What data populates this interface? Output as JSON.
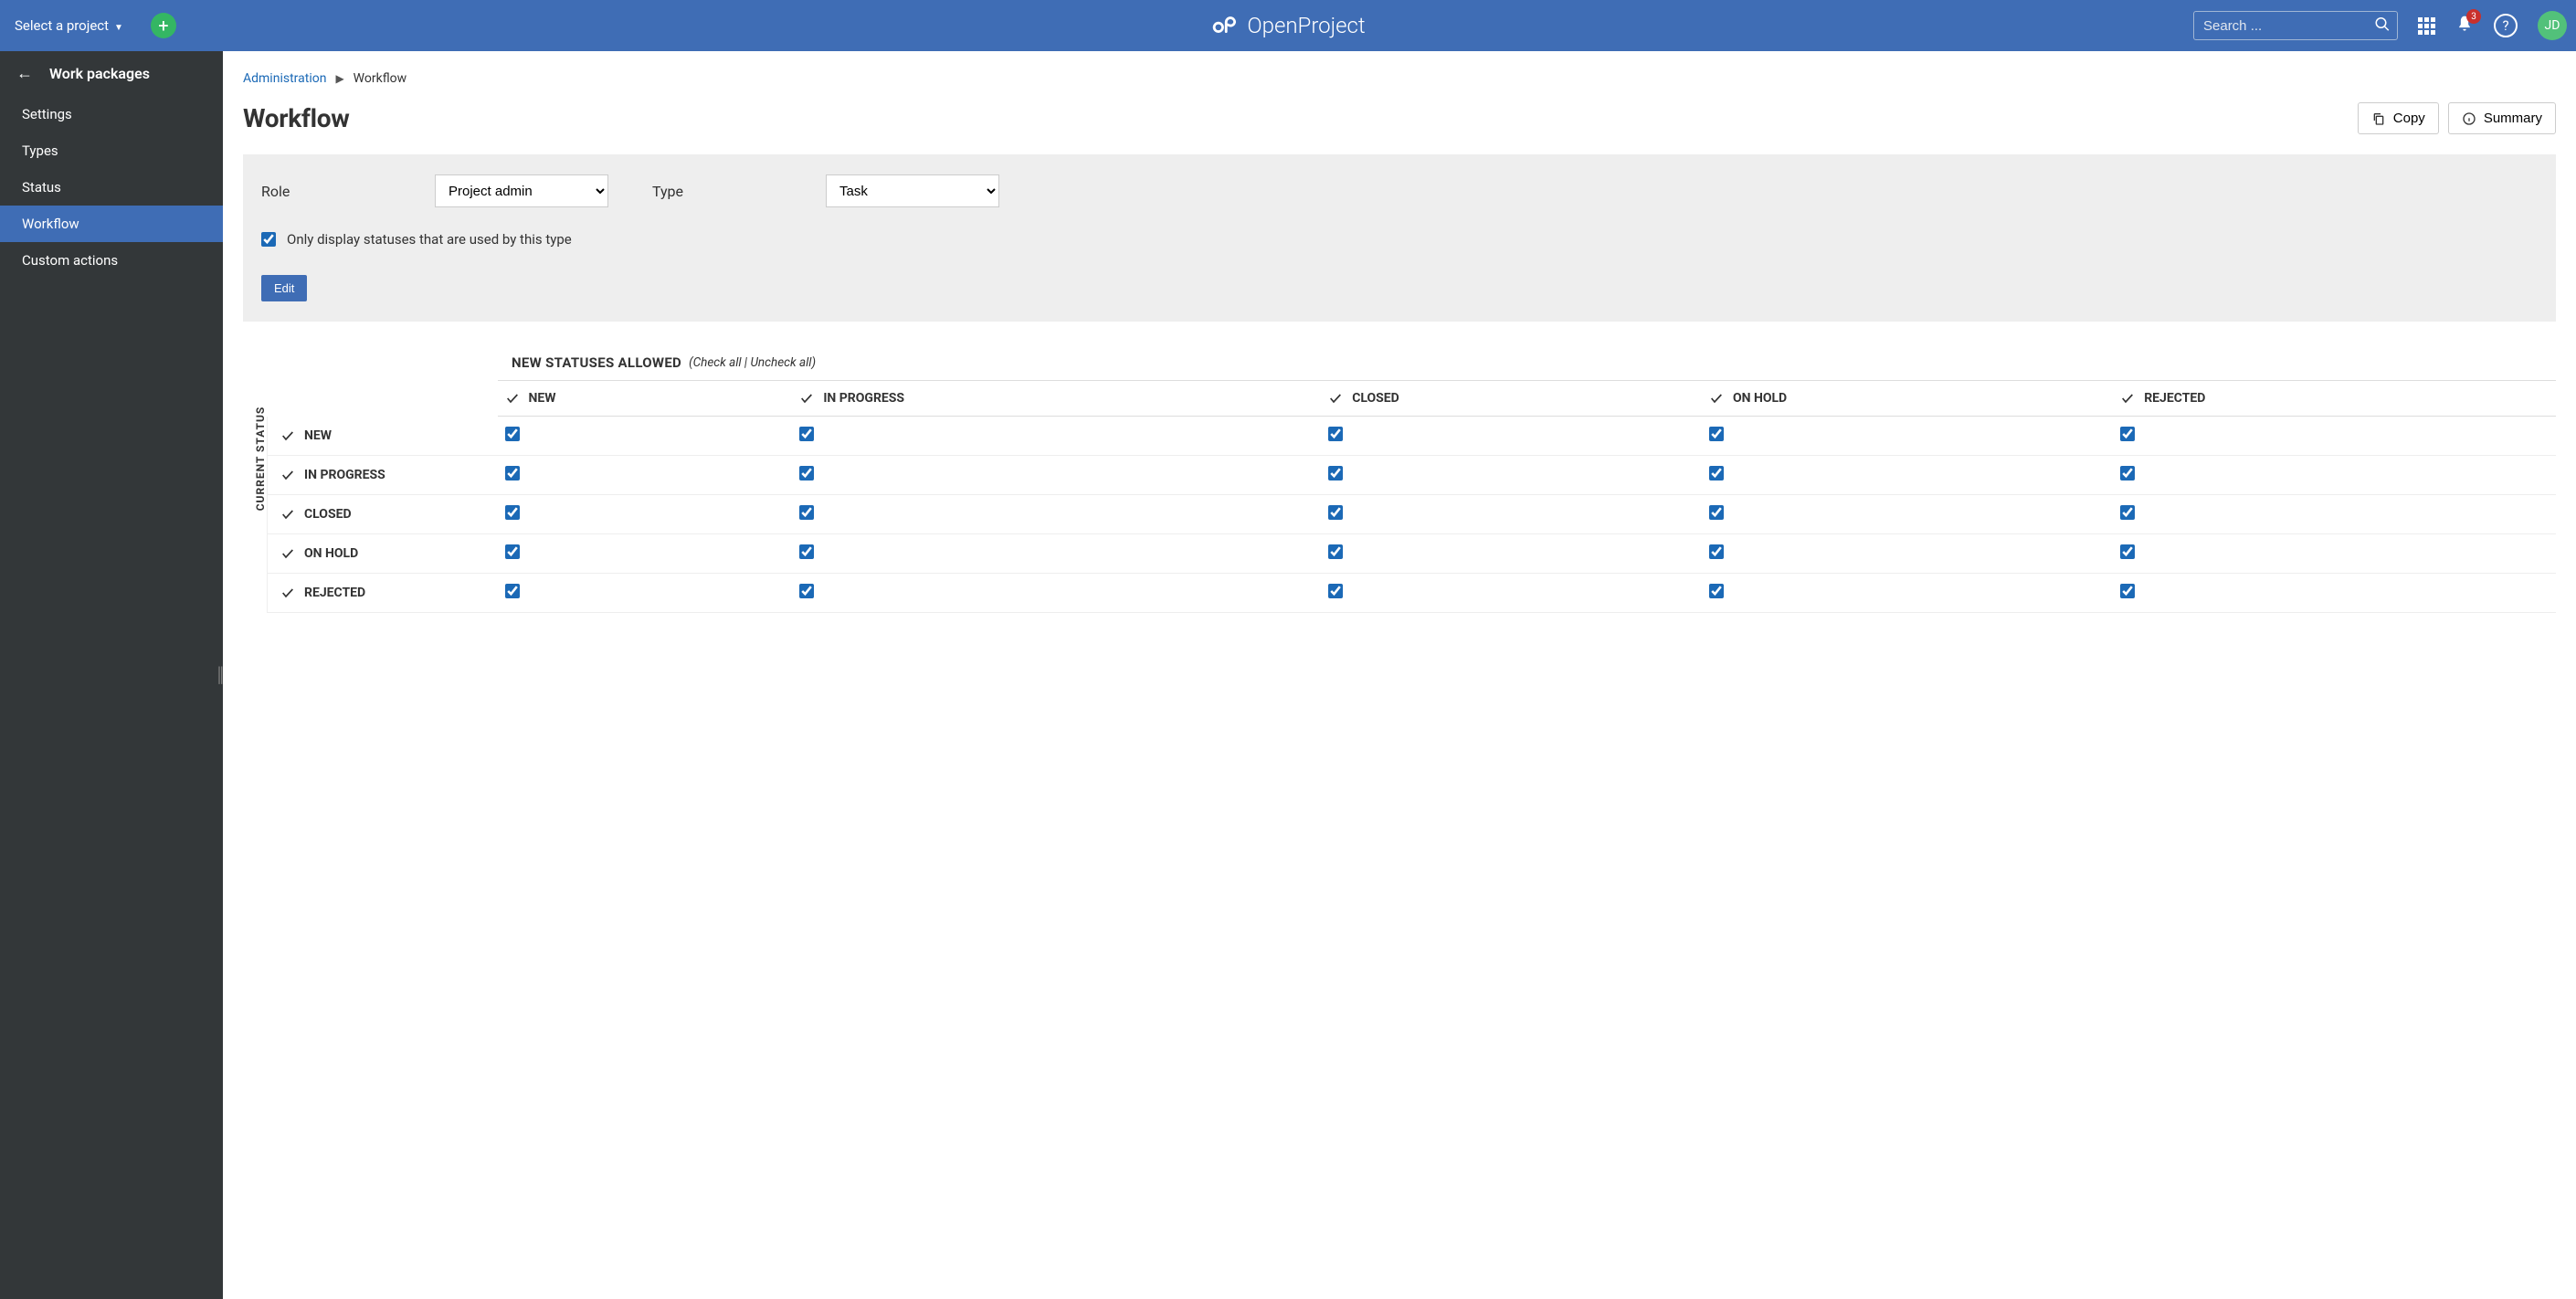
{
  "header": {
    "project_selector": "Select a project",
    "logo_text": "OpenProject",
    "search_placeholder": "Search ...",
    "notification_count": "3",
    "avatar_initials": "JD"
  },
  "sidebar": {
    "title": "Work packages",
    "items": [
      {
        "label": "Settings"
      },
      {
        "label": "Types"
      },
      {
        "label": "Status"
      },
      {
        "label": "Workflow",
        "active": true
      },
      {
        "label": "Custom actions"
      }
    ]
  },
  "breadcrumb": {
    "root": "Administration",
    "current": "Workflow"
  },
  "page": {
    "title": "Workflow",
    "copy_label": "Copy",
    "summary_label": "Summary"
  },
  "filters": {
    "role_label": "Role",
    "role_value": "Project admin",
    "type_label": "Type",
    "type_value": "Task",
    "only_used_label": "Only display statuses that are used by this type",
    "only_used_checked": true,
    "edit_label": "Edit"
  },
  "table": {
    "current_status_label": "CURRENT STATUS",
    "new_statuses_label": "NEW STATUSES ALLOWED",
    "check_all_label": "Check all",
    "uncheck_all_label": "Uncheck all",
    "columns": [
      "NEW",
      "IN PROGRESS",
      "CLOSED",
      "ON HOLD",
      "REJECTED"
    ],
    "rows": [
      {
        "name": "NEW",
        "cells": [
          true,
          true,
          true,
          true,
          true
        ]
      },
      {
        "name": "IN PROGRESS",
        "cells": [
          true,
          true,
          true,
          true,
          true
        ]
      },
      {
        "name": "CLOSED",
        "cells": [
          true,
          true,
          true,
          true,
          true
        ]
      },
      {
        "name": "ON HOLD",
        "cells": [
          true,
          true,
          true,
          true,
          true
        ]
      },
      {
        "name": "REJECTED",
        "cells": [
          true,
          true,
          true,
          true,
          true
        ]
      }
    ]
  }
}
